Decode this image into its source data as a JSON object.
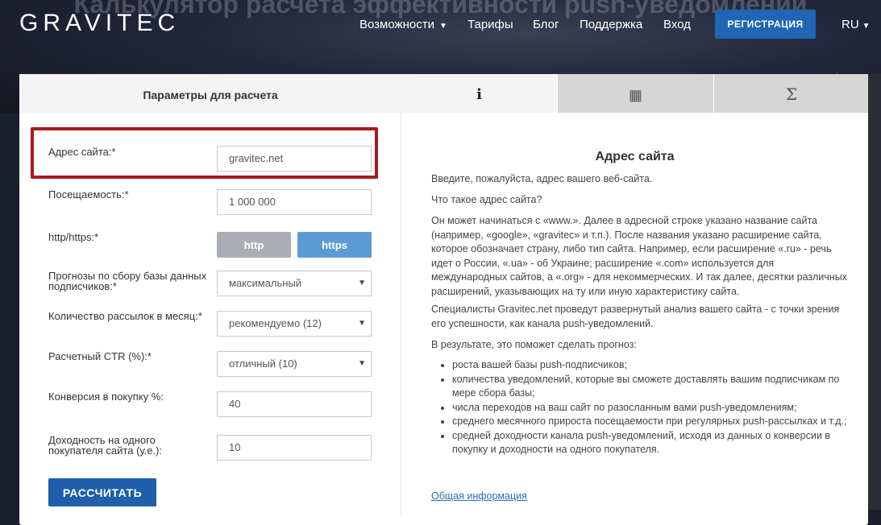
{
  "header": {
    "logo": "GRAVITEC",
    "hero_title": "Калькулятор расчета эффективности push-уведомлений",
    "nav": [
      {
        "label": "Возможности",
        "dropdown": true
      },
      {
        "label": "Тарифы"
      },
      {
        "label": "Блог"
      },
      {
        "label": "Поддержка"
      },
      {
        "label": "Вход"
      }
    ],
    "register_label": "РЕГИСТРАЦИЯ",
    "lang": "RU"
  },
  "tabs": {
    "params_label": "Параметры для расчета",
    "info_symbol": "i",
    "calc_symbol": "▦",
    "sum_symbol": "Σ"
  },
  "form": {
    "site_label": "Адрес сайта:*",
    "site_value": "gravitec.net",
    "traffic_label": "Посещаемость:*",
    "traffic_value": "1 000 000",
    "protocol_label": "http/https:*",
    "http_label": "http",
    "https_label": "https",
    "forecast_label": "Прогнозы по сбору базы данных подписчиков:*",
    "forecast_value": "максимальный",
    "mailings_label": "Количество рассылок в месяц:*",
    "mailings_value": "рекомендуемо (12)",
    "ctr_label": "Расчетный CTR (%):*",
    "ctr_value": "отличный (10)",
    "conversion_label": "Конверсия в покупку %:",
    "conversion_value": "40",
    "revenue_label": "Доходность на одного покупателя сайта (у.е.):",
    "revenue_value": "10",
    "calc_button": "РАССЧИТАТЬ"
  },
  "info": {
    "title": "Адрес сайта",
    "p1": "Введите, пожалуйста, адрес вашего веб-сайта.",
    "p2": "Что такое адрес сайта?",
    "p3": "Он может начинаться с «www.». Далее в адресной строке указано название сайта (например, «google», «gravitec» и т.п.). После названия указано расширение сайта, которое обозначает страну, либо тип сайта. Например, если расширение «.ru» - речь идет о России, «.ua» - об Украине; расширение «.com» используется для международных сайтов, а «.org» - для некоммерческих. И так далее, десятки различных расширений, указывающих на ту или иную характеристику сайта.",
    "p4": "Специалисты Gravitec.net проведут развернутый анализ вашего сайта - с точки зрения его успешности, как канала push-уведомлений.",
    "p5": "В результате, это поможет сделать прогноз:",
    "list": [
      "роста вашей базы push-подписчиков;",
      "количества уведомлений, которые вы сможете доставлять вашим подписчикам по мере сбора базы;",
      "числа переходов на ваш сайт по разосланным вами push-уведомлениям;",
      "среднего месячного прироста посещаемости при регулярных push-рассылках и т.д.;",
      "средней доходности канала push-уведомлений, исходя из данных о конверсии в покупку и доходности на одного покупателя."
    ],
    "link": "Общая информация"
  },
  "colors": {
    "brand_blue": "#1f66b4",
    "https_active": "#5b9bd5",
    "http_inactive": "#aaaeb3",
    "highlight_red": "#a81a1d"
  }
}
